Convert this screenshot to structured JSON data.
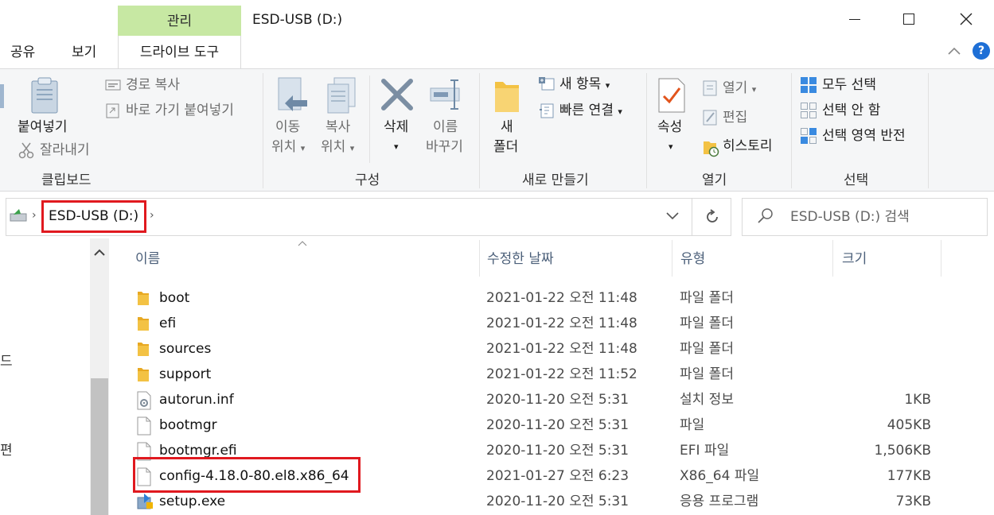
{
  "window": {
    "title": "ESD-USB (D:)",
    "context_tab": "관리",
    "minimize": "—",
    "maximize": "☐",
    "close": "✕"
  },
  "tabs": [
    "공유",
    "보기",
    "드라이브 도구"
  ],
  "ribbon": {
    "clipboard": {
      "label": "클립보드",
      "paste": "붙여넣기",
      "copy_path": "경로 복사",
      "paste_shortcut": "바로 가기 붙여넣기",
      "cut": "잘라내기"
    },
    "organize": {
      "label": "구성",
      "move_to_1": "이동",
      "move_to_2": "위치",
      "copy_to_1": "복사",
      "copy_to_2": "위치",
      "delete": "삭제",
      "rename_1": "이름",
      "rename_2": "바꾸기"
    },
    "new": {
      "label": "새로 만들기",
      "new_folder_1": "새",
      "new_folder_2": "폴더",
      "new_item": "새 항목",
      "easy_access": "빠른 연결"
    },
    "open": {
      "label": "열기",
      "properties": "속성",
      "open": "열기",
      "edit": "편집",
      "history": "히스토리"
    },
    "select": {
      "label": "선택",
      "select_all": "모두 선택",
      "select_none": "선택 안 함",
      "invert": "선택 영역 반전"
    }
  },
  "address": {
    "crumb": "ESD-USB (D:)",
    "search_placeholder": "ESD-USB (D:) 검색"
  },
  "columns": {
    "name": "이름",
    "date": "수정한 날짜",
    "type": "유형",
    "size": "크기"
  },
  "files": [
    {
      "name": "boot",
      "date": "2021-01-22 오전 11:48",
      "type": "파일 폴더",
      "size": "",
      "icon": "folder-icon"
    },
    {
      "name": "efi",
      "date": "2021-01-22 오전 11:48",
      "type": "파일 폴더",
      "size": "",
      "icon": "folder-icon"
    },
    {
      "name": "sources",
      "date": "2021-01-22 오전 11:48",
      "type": "파일 폴더",
      "size": "",
      "icon": "folder-icon"
    },
    {
      "name": "support",
      "date": "2021-01-22 오전 11:52",
      "type": "파일 폴더",
      "size": "",
      "icon": "folder-icon"
    },
    {
      "name": "autorun.inf",
      "date": "2020-11-20 오전 5:31",
      "type": "설치 정보",
      "size": "1KB",
      "icon": "setup-info-icon"
    },
    {
      "name": "bootmgr",
      "date": "2020-11-20 오전 5:31",
      "type": "파일",
      "size": "405KB",
      "icon": "file-icon"
    },
    {
      "name": "bootmgr.efi",
      "date": "2020-11-20 오전 5:31",
      "type": "EFI 파일",
      "size": "1,506KB",
      "icon": "file-icon"
    },
    {
      "name": "config-4.18.0-80.el8.x86_64",
      "date": "2021-01-27 오전 6:23",
      "type": "X86_64 파일",
      "size": "177KB",
      "icon": "file-icon"
    },
    {
      "name": "setup.exe",
      "date": "2020-11-20 오전 5:31",
      "type": "응용 프로그램",
      "size": "73KB",
      "icon": "setup-exe-icon"
    }
  ],
  "left_pane": {
    "frag1": "드",
    "frag2": "편"
  },
  "colors": {
    "accent_context": "#c7e8a3",
    "highlight": "#e0191f",
    "folder": "#f3c244"
  }
}
